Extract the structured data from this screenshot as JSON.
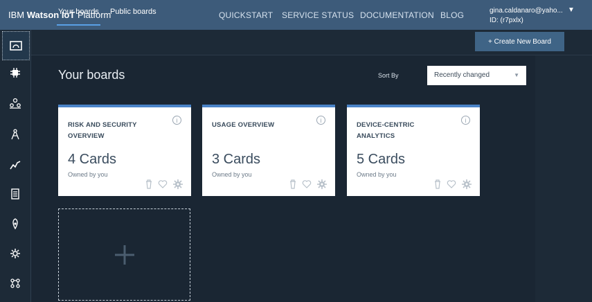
{
  "header": {
    "brand_ibm": "IBM",
    "brand_product": "Watson IoT",
    "brand_suffix": "Platform",
    "nav": [
      "QUICKSTART",
      "SERVICE STATUS",
      "DOCUMENTATION",
      "BLOG"
    ],
    "user_email": "gina.caldanaro@yaho...",
    "user_id": "ID: (r7pxlx)"
  },
  "sidebar": {
    "items": [
      "boards-icon",
      "devices-icon",
      "members-icon",
      "apps-icon",
      "usage-icon",
      "rules-icon",
      "security-icon",
      "settings-icon",
      "extensions-icon"
    ]
  },
  "tabs": {
    "your_boards": "Your boards",
    "public_boards": "Public boards"
  },
  "create_button": "+ Create New Board",
  "main": {
    "title": "Your boards",
    "sort_label": "Sort By",
    "sort_value": "Recently changed"
  },
  "cards": [
    {
      "title": "RISK AND SECURITY OVERVIEW",
      "count": "4 Cards",
      "owner": "Owned by you"
    },
    {
      "title": "USAGE OVERVIEW",
      "count": "3 Cards",
      "owner": "Owned by you"
    },
    {
      "title": "DEVICE-CENTRIC ANALYTICS",
      "count": "5 Cards",
      "owner": "Owned by you"
    }
  ],
  "colors": {
    "topbar": "#3d5b7a",
    "background": "#1d2a37",
    "card_accent": "#4a83c8",
    "button": "#3f6486"
  }
}
